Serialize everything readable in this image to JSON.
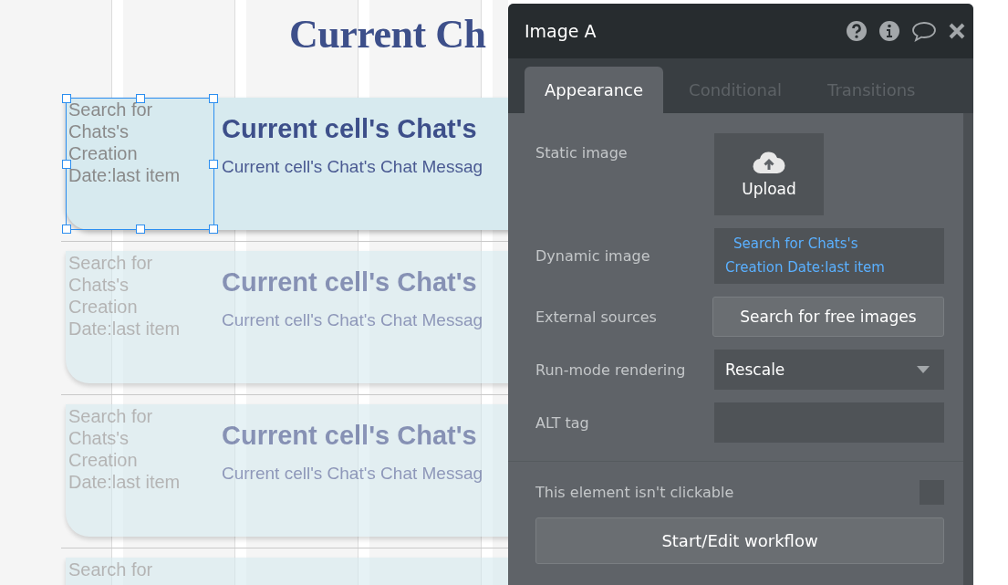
{
  "canvas": {
    "title": "Current Ch",
    "cells": [
      {
        "image_text": "Search for Chats's Creation Date:last item",
        "heading": "Current cell's Chat's",
        "message": "Current cell's Chat's Chat Messag",
        "selected": true,
        "faded": false
      },
      {
        "image_text": "Search for Chats's Creation Date:last item",
        "heading": "Current cell's Chat's",
        "message": "Current cell's Chat's Chat Messag",
        "selected": false,
        "faded": true
      },
      {
        "image_text": "Search for Chats's Creation Date:last item",
        "heading": "Current cell's Chat's",
        "message": "Current cell's Chat's Chat Messag",
        "selected": false,
        "faded": true
      },
      {
        "image_text": "Search for",
        "selected": false,
        "faded": true
      }
    ]
  },
  "panel": {
    "title": "Image A",
    "tabs": [
      {
        "label": "Appearance",
        "selected": true
      },
      {
        "label": "Conditional",
        "selected": false
      },
      {
        "label": "Transitions",
        "selected": false
      }
    ],
    "fields": [
      {
        "kind": "upload",
        "label": "Static image",
        "value": "Upload"
      },
      {
        "kind": "expression",
        "label": "Dynamic image",
        "value": "Search for Chats's Creation Date:last item"
      },
      {
        "kind": "button",
        "label": "External sources",
        "value": "Search for free images"
      },
      {
        "kind": "dropdown",
        "label": "Run-mode rendering",
        "value": "Rescale"
      },
      {
        "kind": "text",
        "label": "ALT tag"
      }
    ],
    "clickable_option": {
      "label": "This element isn't clickable",
      "checked": false
    },
    "workflow_button": "Start/Edit workflow"
  }
}
